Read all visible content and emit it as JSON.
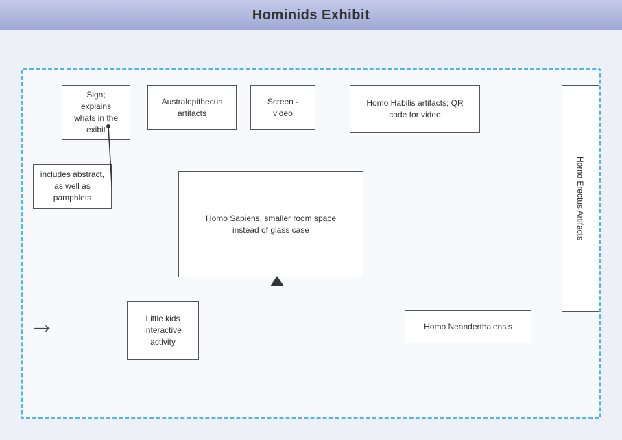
{
  "title": "Hominids Exhibit",
  "boxes": {
    "sign": {
      "label": "Sign;\nexplains\nwhats in the\nexibit"
    },
    "australopithecus": {
      "label": "Australopithecus\nartifacts"
    },
    "screen_video": {
      "label": "Screen -\nvideo"
    },
    "homo_habilis": {
      "label": "Homo Habilis artifacts; QR\ncode for video"
    },
    "homo_sapiens": {
      "label": "Homo Sapiens, smaller room space\ninstead of glass case"
    },
    "homo_erectus": {
      "label": "Homo Erectus Artifacts"
    },
    "little_kids": {
      "label": "Little kids\ninteractive\nactivity"
    },
    "homo_neanderthalensis": {
      "label": "Homo Neanderthalensis"
    },
    "pamphlets": {
      "label": "includes abstract,\nas well as\npamphlets"
    }
  },
  "arrow": {
    "symbol": "→"
  }
}
